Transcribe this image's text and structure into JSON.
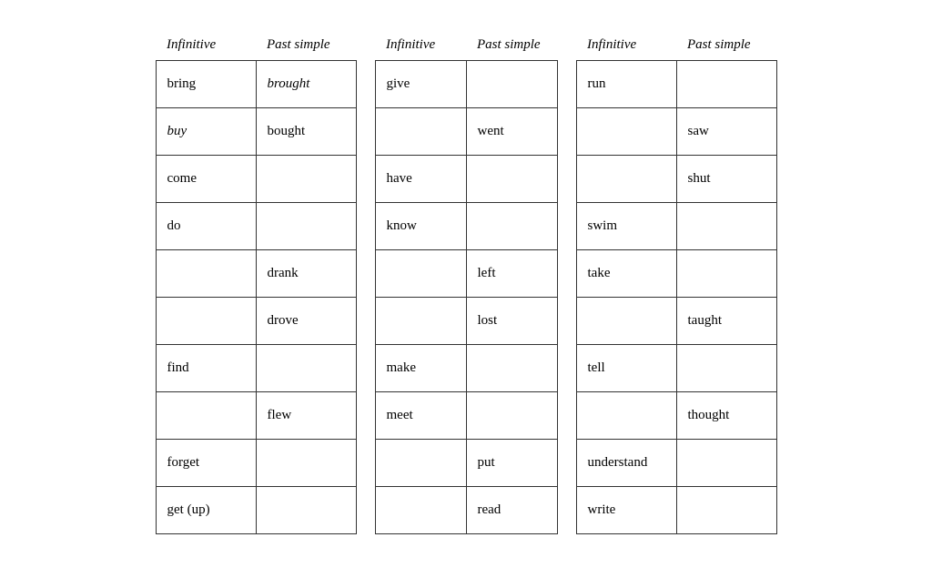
{
  "headers": {
    "infinitive": "Infinitive",
    "past_simple": "Past simple"
  },
  "table1": {
    "rows": [
      {
        "infinitive": "bring",
        "past": "brought",
        "past_italic": true
      },
      {
        "infinitive": "buy",
        "infinitive_italic": true,
        "past": "bought"
      },
      {
        "infinitive": "come",
        "past": ""
      },
      {
        "infinitive": "do",
        "past": ""
      },
      {
        "infinitive": "",
        "past": "drank"
      },
      {
        "infinitive": "",
        "past": "drove"
      },
      {
        "infinitive": "find",
        "past": ""
      },
      {
        "infinitive": "",
        "past": "flew"
      },
      {
        "infinitive": "forget",
        "past": ""
      },
      {
        "infinitive": "get (up)",
        "past": ""
      }
    ]
  },
  "table2": {
    "rows": [
      {
        "infinitive": "give",
        "past": ""
      },
      {
        "infinitive": "",
        "past": "went"
      },
      {
        "infinitive": "have",
        "past": ""
      },
      {
        "infinitive": "know",
        "past": ""
      },
      {
        "infinitive": "",
        "past": "left"
      },
      {
        "infinitive": "",
        "past": "lost"
      },
      {
        "infinitive": "make",
        "past": ""
      },
      {
        "infinitive": "meet",
        "past": ""
      },
      {
        "infinitive": "",
        "past": "put"
      },
      {
        "infinitive": "",
        "past": "read"
      }
    ]
  },
  "table3": {
    "rows": [
      {
        "infinitive": "run",
        "past": ""
      },
      {
        "infinitive": "",
        "past": "saw"
      },
      {
        "infinitive": "",
        "past": "shut"
      },
      {
        "infinitive": "swim",
        "past": ""
      },
      {
        "infinitive": "take",
        "past": ""
      },
      {
        "infinitive": "",
        "past": "taught"
      },
      {
        "infinitive": "tell",
        "past": ""
      },
      {
        "infinitive": "",
        "past": "thought"
      },
      {
        "infinitive": "understand",
        "past": ""
      },
      {
        "infinitive": "write",
        "past": ""
      }
    ]
  }
}
